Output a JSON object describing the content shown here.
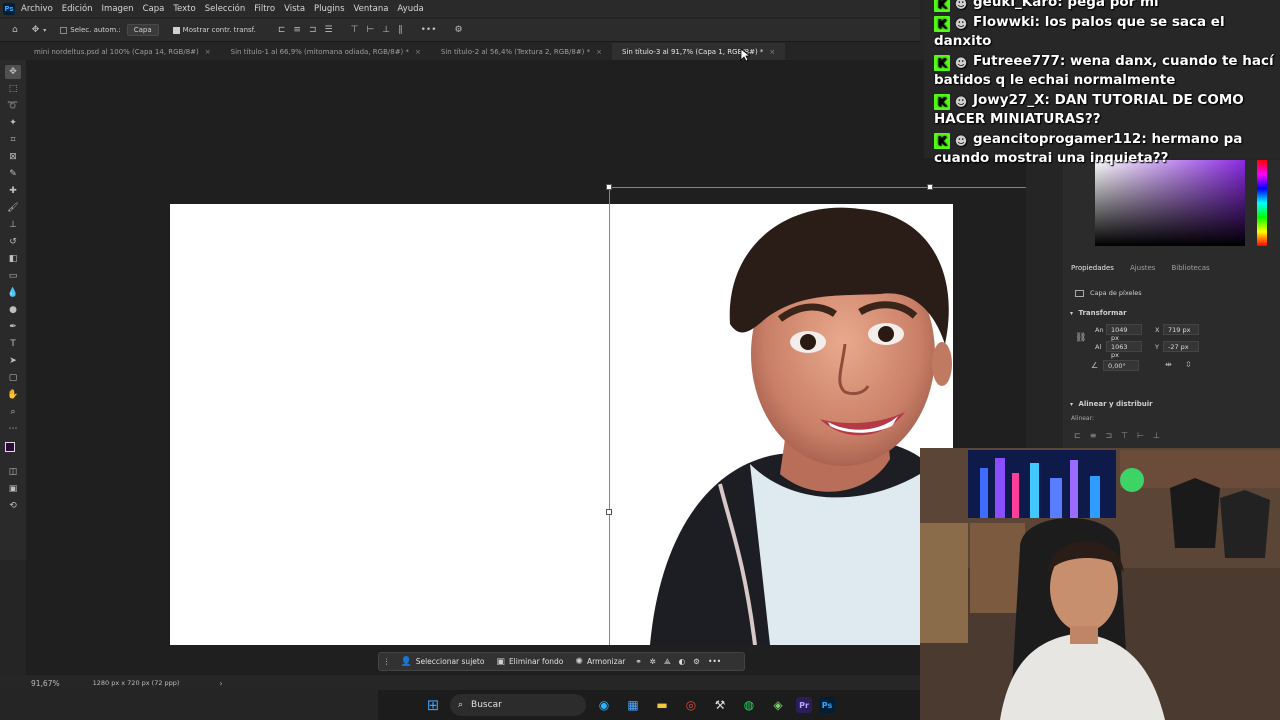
{
  "menu": [
    "Archivo",
    "Edición",
    "Imagen",
    "Capa",
    "Texto",
    "Selección",
    "Filtro",
    "Vista",
    "Plugins",
    "Ventana",
    "Ayuda"
  ],
  "options": {
    "auto_select_label": "Selec. autom.:",
    "layer_select": "Capa",
    "show_transform_label": "Mostrar contr. transf."
  },
  "tabs": [
    {
      "label": "mini nordeltus.psd al 100% (Capa 14, RGB/8#)"
    },
    {
      "label": "Sin título-1 al 66,9% (mitomana odiada, RGB/8#) *"
    },
    {
      "label": "Sin título-2 al 56,4% (Textura 2, RGB/8#) *"
    },
    {
      "label": "Sin título-3 al 91,7% (Capa 1, RGB/8#) *"
    }
  ],
  "context_bar": {
    "select_subject": "Seleccionar sujeto",
    "remove_bg": "Eliminar fondo",
    "harmonize": "Armonizar"
  },
  "status": {
    "zoom": "91,67%",
    "doc_info": "1280 px x 720 px (72 ppp)"
  },
  "panel": {
    "tabs": [
      "Propiedades",
      "Ajustes",
      "Bibliotecas"
    ],
    "layer_type": "Capa de píxeles",
    "transform_title": "Transformar",
    "w_label": "An",
    "w_value": "1049 px",
    "h_label": "Al",
    "h_value": "1063 px",
    "x_label": "X",
    "x_value": "719 px",
    "y_label": "Y",
    "y_value": "-27 px",
    "angle_value": "0,00°",
    "align_title": "Alinear y distribuir",
    "align_label": "Alinear:"
  },
  "chat": [
    {
      "user": "geuki_Karo:",
      "text": "pega por mi"
    },
    {
      "user": "Flowwki:",
      "text": "los palos que se saca el danxito"
    },
    {
      "user": "Futreee777:",
      "text": "wena danx, cuando te hací batidos q le echai normalmente"
    },
    {
      "user": "Jowy27_X:",
      "text": "DAN TUTORIAL DE COMO HACER MINIATURAS??"
    },
    {
      "user": "geancitoprogamer112:",
      "text": "hermano pa cuando mostrai una inquieta??"
    }
  ],
  "taskbar": {
    "search_placeholder": "Buscar"
  },
  "colors": {
    "accent": "#31a8ff",
    "kick_green": "#53fc18",
    "foreground": "#2b0a3d"
  }
}
